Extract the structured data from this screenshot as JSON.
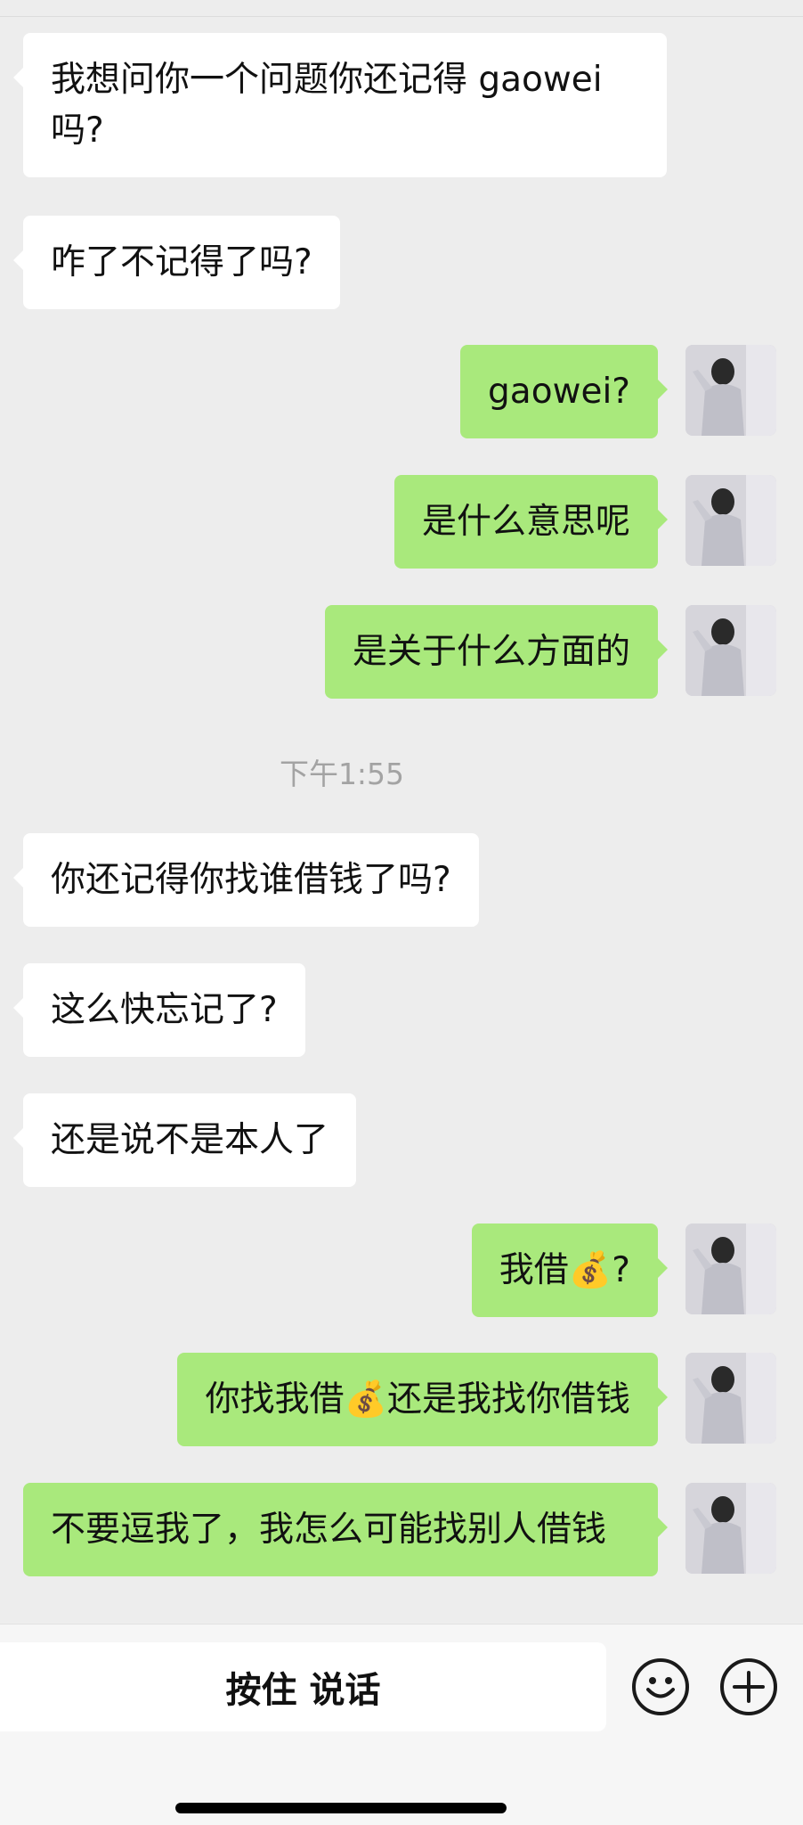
{
  "chat": {
    "messages": [
      {
        "side": "left",
        "text": "我想问你一个问题你还记得 gaowei 吗?"
      },
      {
        "side": "left",
        "text": "咋了不记得了吗?"
      },
      {
        "side": "right",
        "text": "gaowei?"
      },
      {
        "side": "right",
        "text": "是什么意思呢"
      },
      {
        "side": "right",
        "text": "是关于什么方面的"
      },
      {
        "side": "left",
        "text": "你还记得你找谁借钱了吗?"
      },
      {
        "side": "left",
        "text": "这么快忘记了?"
      },
      {
        "side": "left",
        "text": "还是说不是本人了"
      },
      {
        "side": "right",
        "text": "我借💰?"
      },
      {
        "side": "right",
        "text": "你找我借💰还是我找你借钱"
      },
      {
        "side": "right",
        "text": "不要逗我了，我怎么可能找别人借钱"
      }
    ],
    "timestamp": "下午1:55"
  },
  "input_bar": {
    "voice_label": "按住 说话",
    "emoji_icon": "emoji-face-icon",
    "plus_icon": "plus-icon"
  },
  "colors": {
    "background": "#ededed",
    "self_bubble": "#a9e97c",
    "other_bubble": "#ffffff"
  }
}
